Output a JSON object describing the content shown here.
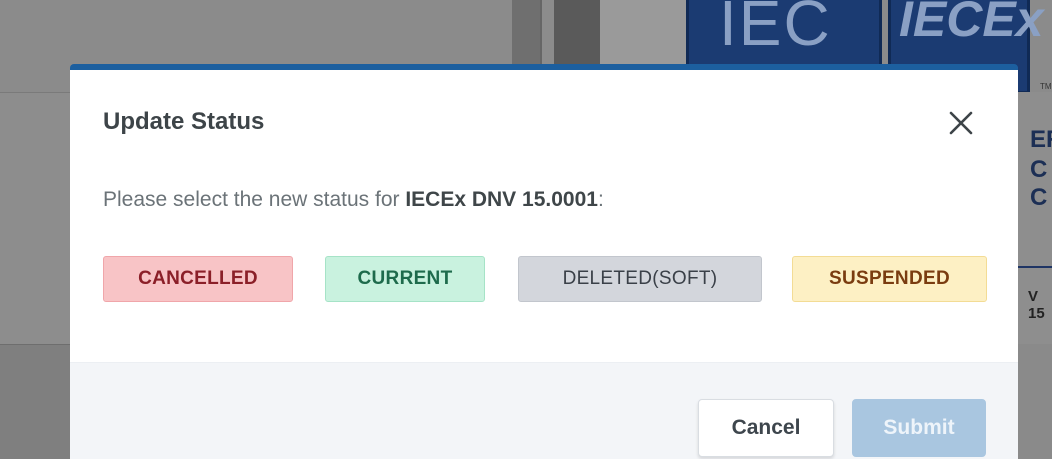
{
  "background": {
    "logo_iec_text": "IEC",
    "logo_iecex_text": "IECEx",
    "tm_text": "TM",
    "side_text_1": "ER",
    "side_text_2": "C C",
    "side_text_3": "V 15"
  },
  "modal": {
    "title": "Update Status",
    "close_icon": "close-icon",
    "message_prefix": "Please select the new status for ",
    "certificate_id": "IECEx DNV 15.0001",
    "message_suffix": ":",
    "statuses": [
      {
        "label": "CANCELLED",
        "color": "#f8c4c6"
      },
      {
        "label": "CURRENT",
        "color": "#c9f2df"
      },
      {
        "label": "DELETED(SOFT)",
        "color": "#d3d6dc"
      },
      {
        "label": "SUSPENDED",
        "color": "#fdf0c4"
      }
    ],
    "cancel_label": "Cancel",
    "submit_label": "Submit"
  },
  "colors": {
    "accent": "#1c5f9f",
    "submit_disabled": "#a9c6e0"
  }
}
